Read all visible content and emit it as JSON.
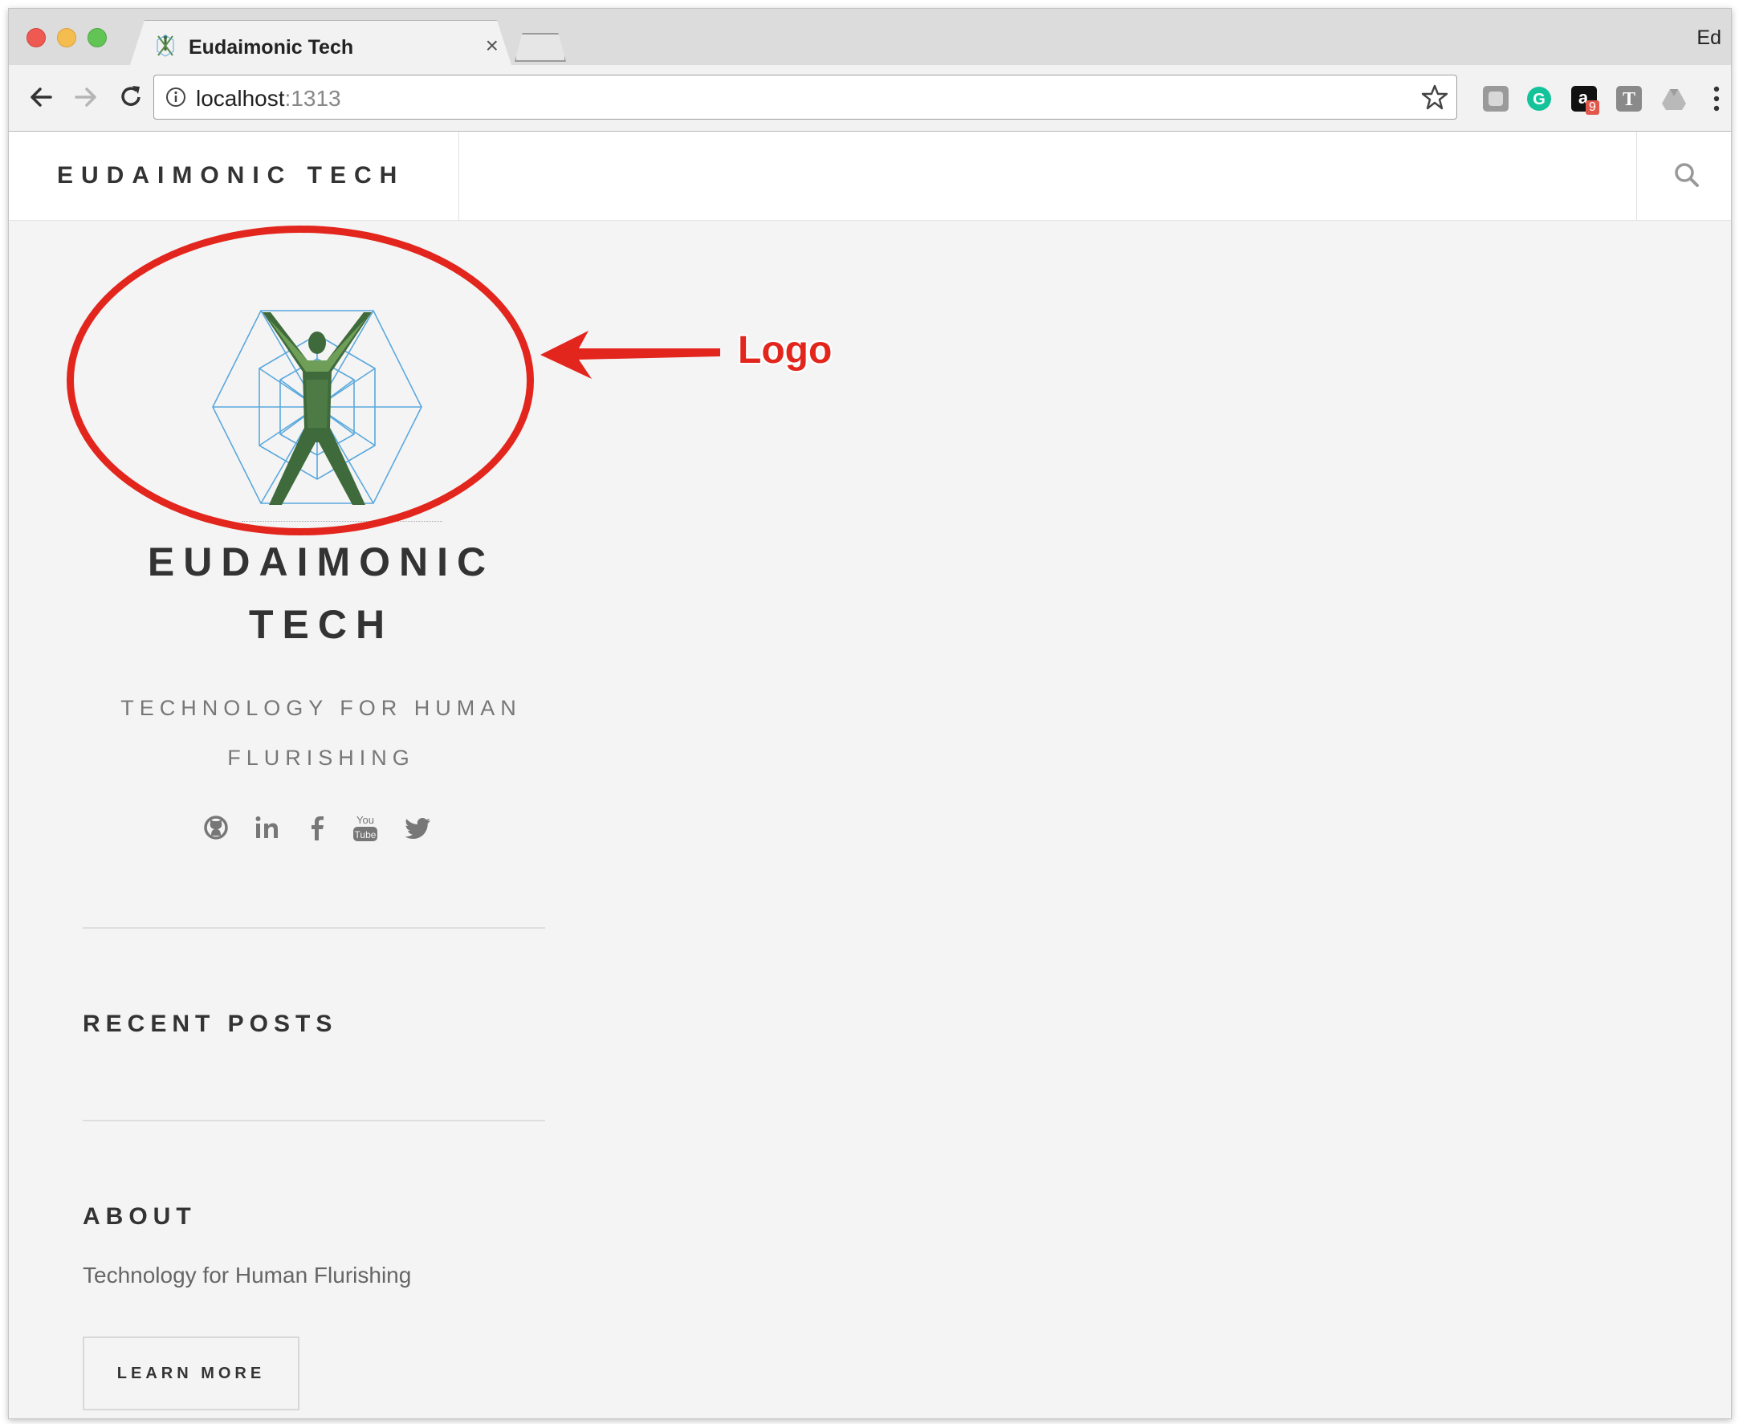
{
  "browser": {
    "tab": {
      "title": "Eudaimonic Tech",
      "close_label": "×"
    },
    "profile_name": "Ed",
    "address_bar": {
      "host": "localhost",
      "port": ":1313"
    },
    "extensions": [
      {
        "name": "gray-extension-icon"
      },
      {
        "name": "grammarly-icon",
        "color": "#15c39a"
      },
      {
        "name": "amazon-assistant-icon",
        "badge": "9"
      },
      {
        "name": "t-extension-icon"
      },
      {
        "name": "google-drive-icon"
      }
    ]
  },
  "site_header": {
    "brand": "EUDAIMONIC TECH"
  },
  "annotation": {
    "label": "Logo",
    "color": "#e3261d"
  },
  "sidebar": {
    "site_title": "EUDAIMONIC TECH",
    "tagline": "TECHNOLOGY FOR HUMAN FLURISHING",
    "socials": [
      {
        "icon": "github-icon"
      },
      {
        "icon": "linkedin-icon"
      },
      {
        "icon": "facebook-icon"
      },
      {
        "icon": "youtube-icon"
      },
      {
        "icon": "twitter-icon"
      }
    ],
    "recent_posts": {
      "heading": "RECENT POSTS"
    },
    "about": {
      "heading": "ABOUT",
      "text": "Technology for Human Flurishing",
      "button": "LEARN MORE"
    }
  }
}
